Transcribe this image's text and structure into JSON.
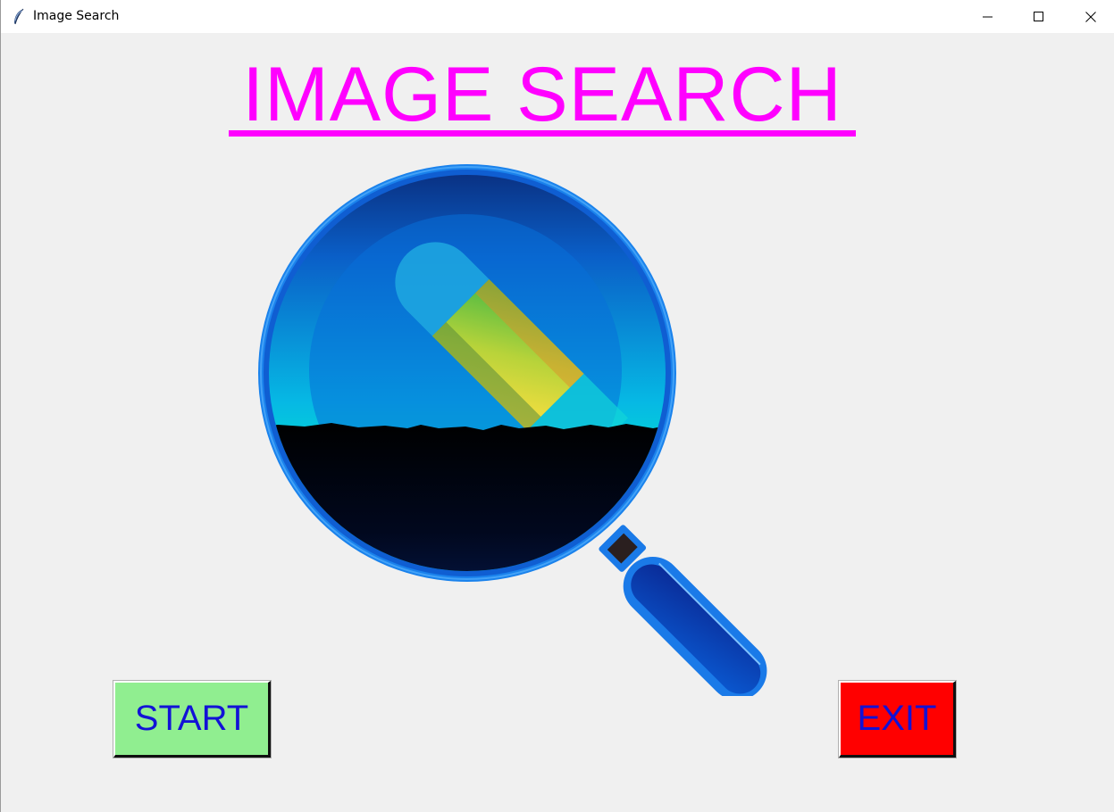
{
  "window": {
    "title": "Image Search",
    "app_icon": "feather-icon",
    "controls": {
      "minimize_icon": "minimize-icon",
      "maximize_icon": "maximize-icon",
      "close_icon": "close-icon"
    }
  },
  "main": {
    "heading": "IMAGE SEARCH",
    "heading_color": "#ff00ff",
    "logo": "magnifying-glass-image-logo"
  },
  "buttons": {
    "start_label": "START",
    "start_color": "#90ee90",
    "exit_label": "EXIT",
    "exit_color": "#ff0000",
    "label_color": "#1212d6"
  }
}
